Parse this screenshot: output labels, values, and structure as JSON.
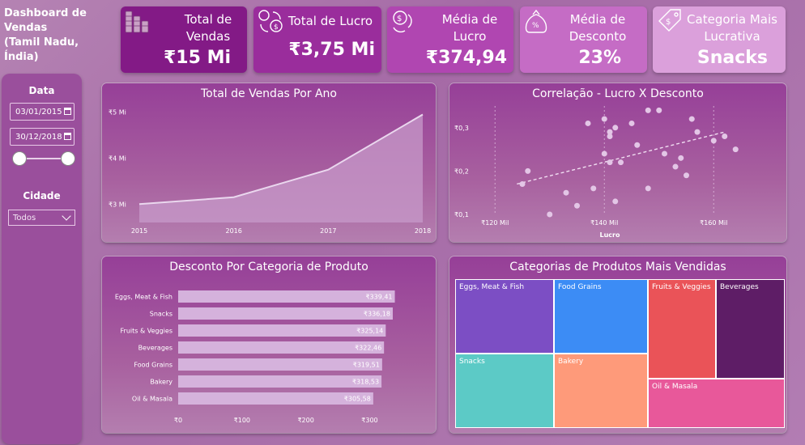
{
  "header": {
    "title_line1": "Dashboard de Vendas",
    "title_line2": "(Tamil Nadu, Índia)"
  },
  "kpis": [
    {
      "label": "Total de Vendas",
      "value": "₹15 Mi",
      "icon": "coins-icon",
      "color": "#831a86"
    },
    {
      "label": "Total de Lucro",
      "value": "₹3,75 Mi",
      "icon": "money-exchange-icon",
      "color": "#9a2d9c"
    },
    {
      "label": "Média de Lucro",
      "value": "₹374,94",
      "icon": "money-cycle-icon",
      "color": "#b046b1"
    },
    {
      "label": "Média de Desconto",
      "value": "23%",
      "icon": "discount-bag-icon",
      "color": "#c56cc5"
    },
    {
      "label": "Categoria Mais Lucrativa",
      "value": "Snacks",
      "icon": "price-tag-icon",
      "color": "#dba0db"
    }
  ],
  "filters": {
    "date_label": "Data",
    "date_start": "03/01/2015",
    "date_end": "30/12/2018",
    "city_label": "Cidade",
    "city_value": "Todos"
  },
  "charts": {
    "sales_title": "Total de Vendas Por Ano",
    "corr_title": "Correlação - Lucro X Desconto",
    "discount_title": "Desconto Por Categoria de Produto",
    "treemap_title": "Categorias de Produtos Mais Vendidas"
  },
  "chart_data": [
    {
      "type": "area",
      "title": "Total de Vendas Por Ano",
      "x": [
        "2015",
        "2016",
        "2017",
        "2018"
      ],
      "values": [
        3.0,
        3.15,
        3.75,
        4.95
      ],
      "ytick_labels": [
        "₹3 Mi",
        "₹4 Mi",
        "₹5 Mi"
      ],
      "yticks": [
        3,
        4,
        5
      ],
      "ylim": [
        2.6,
        5.1
      ],
      "color": "#d9b4e0"
    },
    {
      "type": "scatter",
      "title": "Correlação - Lucro X Desconto",
      "xlabel": "Lucro",
      "xticks": [
        120,
        140,
        160
      ],
      "xtick_labels": [
        "₹120 Mil",
        "₹140 Mil",
        "₹160 Mil"
      ],
      "yticks": [
        0.1,
        0.2,
        0.3
      ],
      "ytick_labels": [
        "₹0,1",
        "₹0,2",
        "₹0,3"
      ],
      "xlim": [
        117,
        165
      ],
      "ylim": [
        0.1,
        0.35
      ],
      "points": [
        [
          125,
          0.17
        ],
        [
          126,
          0.2
        ],
        [
          130,
          0.1
        ],
        [
          133,
          0.15
        ],
        [
          135,
          0.12
        ],
        [
          137,
          0.31
        ],
        [
          138,
          0.16
        ],
        [
          140,
          0.32
        ],
        [
          140,
          0.24
        ],
        [
          141,
          0.28
        ],
        [
          141,
          0.29
        ],
        [
          141,
          0.22
        ],
        [
          142,
          0.13
        ],
        [
          142,
          0.3
        ],
        [
          143,
          0.22
        ],
        [
          145,
          0.31
        ],
        [
          146,
          0.26
        ],
        [
          148,
          0.16
        ],
        [
          148,
          0.34
        ],
        [
          150,
          0.34
        ],
        [
          151,
          0.24
        ],
        [
          153,
          0.21
        ],
        [
          154,
          0.23
        ],
        [
          155,
          0.19
        ],
        [
          156,
          0.32
        ],
        [
          157,
          0.29
        ],
        [
          160,
          0.27
        ],
        [
          162,
          0.28
        ],
        [
          164,
          0.25
        ]
      ],
      "trendline": [
        [
          124,
          0.17
        ],
        [
          162,
          0.29
        ]
      ]
    },
    {
      "type": "bar",
      "title": "Desconto Por Categoria de Produto",
      "categories": [
        "Eggs, Meat & Fish",
        "Snacks",
        "Fruits & Veggies",
        "Beverages",
        "Food Grains",
        "Bakery",
        "Oil & Masala"
      ],
      "values": [
        339.41,
        336.18,
        325.14,
        322.46,
        319.51,
        318.53,
        305.58
      ],
      "value_labels": [
        "₹339,41",
        "₹336,18",
        "₹325,14",
        "₹322,46",
        "₹319,51",
        "₹318,53",
        "₹305,58"
      ],
      "xticks": [
        0,
        100,
        200,
        300
      ],
      "xtick_labels": [
        "₹0",
        "₹100",
        "₹200",
        "₹300"
      ],
      "xlim": [
        0,
        340
      ]
    },
    {
      "type": "treemap",
      "title": "Categorias de Produtos Mais Vendidas",
      "items": [
        {
          "name": "Eggs, Meat & Fish",
          "color": "#7c4ec4"
        },
        {
          "name": "Food Grains",
          "color": "#3c8cf5"
        },
        {
          "name": "Fruits & Veggies",
          "color": "#ea5358"
        },
        {
          "name": "Beverages",
          "color": "#5e1d66"
        },
        {
          "name": "Snacks",
          "color": "#5ccac6"
        },
        {
          "name": "Bakery",
          "color": "#fe9a7a"
        },
        {
          "name": "Oil & Masala",
          "color": "#e8589a"
        }
      ]
    }
  ]
}
